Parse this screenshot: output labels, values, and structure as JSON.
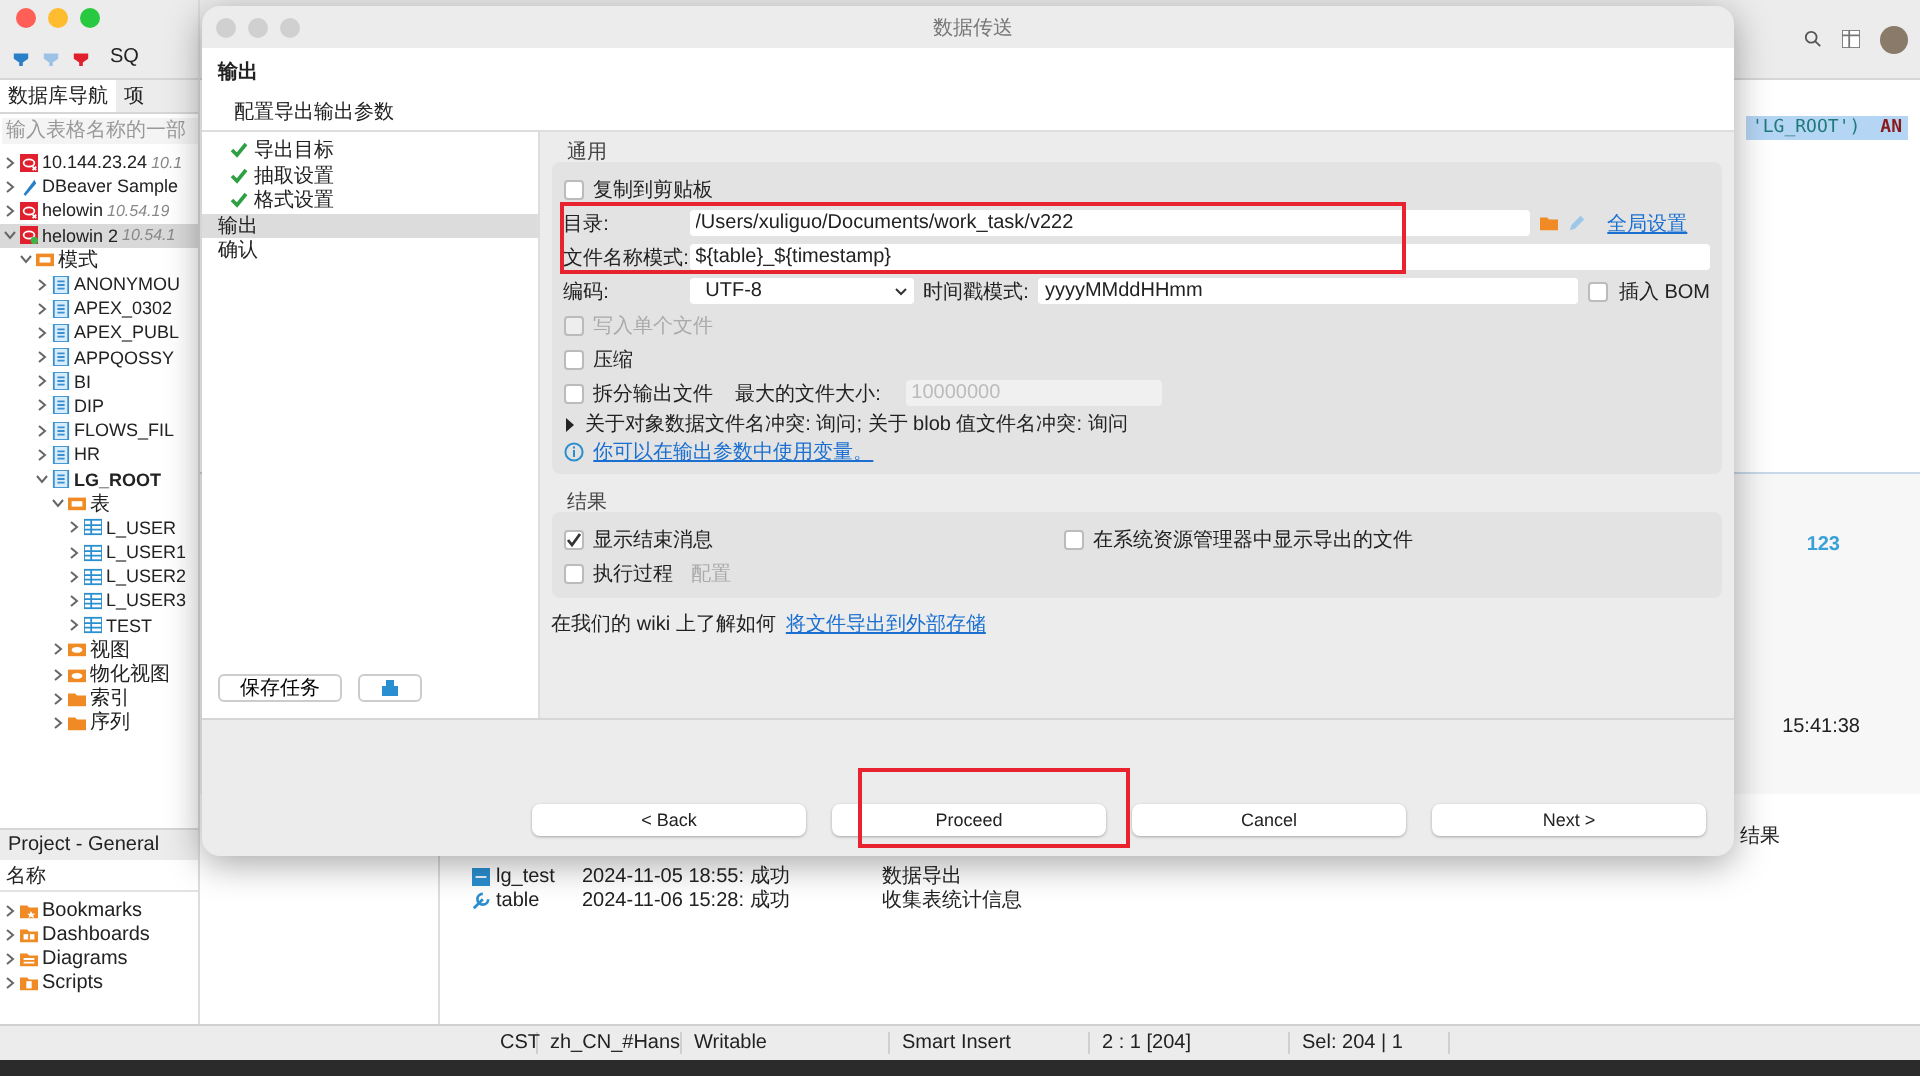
{
  "app": {
    "toolbar": {
      "tab_stub": "SQ"
    },
    "navigator": {
      "tabs": [
        {
          "label": "数据库导航",
          "selected": true
        },
        {
          "label": "项",
          "selected": false
        }
      ],
      "search": {
        "placeholder": "输入表格名称的一部"
      },
      "tree": [
        {
          "label": "10.144.23.24",
          "note": "10.1",
          "kind": "oracle",
          "expanded": false,
          "selected": false
        },
        {
          "label": "DBeaver Sample",
          "kind": "sample",
          "expanded": false,
          "selected": false
        },
        {
          "label": "helowin",
          "note": "10.54.19",
          "kind": "oracle",
          "expanded": false,
          "selected": false
        },
        {
          "label": "helowin 2",
          "note": "10.54.1",
          "kind": "oracle-connected",
          "expanded": true,
          "selected": true,
          "children": [
            {
              "label": "模式",
              "kind": "schemas",
              "expanded": true,
              "selected": false,
              "children": [
                {
                  "label": "ANONYMOU",
                  "kind": "schema",
                  "expanded": false,
                  "selected": false,
                  "active": false
                },
                {
                  "label": "APEX_0302",
                  "kind": "schema",
                  "expanded": false,
                  "selected": false,
                  "active": false
                },
                {
                  "label": "APEX_PUBL",
                  "kind": "schema",
                  "expanded": false,
                  "selected": false,
                  "active": false
                },
                {
                  "label": "APPQOSSY",
                  "kind": "schema",
                  "expanded": false,
                  "selected": false,
                  "active": false
                },
                {
                  "label": "BI",
                  "kind": "schema",
                  "expanded": false,
                  "selected": false,
                  "active": false
                },
                {
                  "label": "DIP",
                  "kind": "schema",
                  "expanded": false,
                  "selected": false,
                  "active": false
                },
                {
                  "label": "FLOWS_FIL",
                  "kind": "schema",
                  "expanded": false,
                  "selected": false,
                  "active": false
                },
                {
                  "label": "HR",
                  "kind": "schema",
                  "expanded": false,
                  "selected": false,
                  "active": false
                },
                {
                  "label": "LG_ROOT",
                  "kind": "schema",
                  "expanded": true,
                  "selected": false,
                  "active": true,
                  "children": [
                    {
                      "label": "表",
                      "kind": "tables",
                      "expanded": true,
                      "selected": false,
                      "children": [
                        {
                          "label": "L_USER",
                          "kind": "table",
                          "expanded": false,
                          "selected": false
                        },
                        {
                          "label": "L_USER1",
                          "kind": "table",
                          "expanded": false,
                          "selected": false
                        },
                        {
                          "label": "L_USER2",
                          "kind": "table",
                          "expanded": false,
                          "selected": false
                        },
                        {
                          "label": "L_USER3",
                          "kind": "table",
                          "expanded": false,
                          "selected": false
                        },
                        {
                          "label": "TEST",
                          "kind": "table",
                          "expanded": false,
                          "selected": false
                        }
                      ]
                    },
                    {
                      "label": "视图",
                      "kind": "views",
                      "expanded": false,
                      "selected": false
                    },
                    {
                      "label": "物化视图",
                      "kind": "views",
                      "expanded": false,
                      "selected": false
                    },
                    {
                      "label": "索引",
                      "kind": "folder",
                      "expanded": false,
                      "selected": false
                    },
                    {
                      "label": "序列",
                      "kind": "folder",
                      "expanded": false,
                      "selected": false
                    }
                  ]
                }
              ]
            }
          ]
        }
      ]
    },
    "project": {
      "title": "Project - General",
      "column": "名称",
      "items": [
        {
          "label": "Bookmarks",
          "kind": "bookmarks"
        },
        {
          "label": "Dashboards",
          "kind": "dashboards"
        },
        {
          "label": "Diagrams",
          "kind": "diagrams"
        },
        {
          "label": "Scripts",
          "kind": "scripts"
        }
      ]
    },
    "editor": {
      "code": "'LG_ROOT')",
      "code_tail": "AN"
    },
    "results": {
      "counter": "123",
      "time": "15:41:38",
      "column": "结果"
    },
    "history": [
      {
        "name": "lg_test",
        "kind": "export",
        "time": "2024-11-05 18:55: 成功",
        "task": "数据导出"
      },
      {
        "name": "table",
        "kind": "tool",
        "time": "2024-11-06 15:28: 成功",
        "task": "收集表统计信息"
      }
    ],
    "status_bar": [
      "CST",
      "zh_CN_#Hans",
      "Writable",
      "Smart Insert",
      "2 : 1 [204]",
      "Sel: 204 | 1"
    ]
  },
  "dialog": {
    "title": "数据传送",
    "heading": "输出",
    "subheading": "配置导出输出参数",
    "steps": [
      {
        "label": "导出目标",
        "done": true,
        "selected": false
      },
      {
        "label": "抽取设置",
        "done": true,
        "selected": false
      },
      {
        "label": "格式设置",
        "done": true,
        "selected": false
      },
      {
        "label": "输出",
        "done": false,
        "selected": true
      },
      {
        "label": "确认",
        "done": false,
        "selected": false
      }
    ],
    "save_task": "保存任务",
    "general": {
      "title": "通用",
      "copy_clipboard": {
        "label": "复制到剪贴板",
        "checked": false
      },
      "paths": {
        "highlighted": true,
        "directory": {
          "label": "目录:",
          "value": "/Users/xuliguo/Documents/work_task/v222"
        },
        "file_pattern": {
          "label": "文件名称模式:",
          "value": "${table}_${timestamp}"
        }
      },
      "global_settings": "全局设置",
      "encoding": {
        "label": "编码:",
        "value": "UTF-8"
      },
      "timestamp": {
        "label": "时间戳模式:",
        "value": "yyyyMMddHHmm"
      },
      "bom": {
        "label": "插入 BOM",
        "checked": false
      },
      "single_file": {
        "label": "写入单个文件",
        "checked": false,
        "disabled": true
      },
      "compress": {
        "label": "压缩",
        "checked": false
      },
      "split": {
        "label": "拆分输出文件",
        "checked": false
      },
      "max_size": {
        "label": "最大的文件大小:",
        "placeholder": "10000000",
        "disabled": true
      },
      "conflicts": "关于对象数据文件名冲突: 询问; 关于 blob 值文件名冲突: 询问",
      "variables_link": "你可以在输出参数中使用变量。"
    },
    "result": {
      "title": "结果",
      "show_message": {
        "label": "显示结束消息",
        "checked": true
      },
      "show_in_explorer": {
        "label": "在系统资源管理器中显示导出的文件",
        "checked": false
      },
      "exec_process": {
        "label": "执行过程",
        "checked": false
      },
      "configure": {
        "label": "配置",
        "disabled": true
      }
    },
    "wiki": {
      "text": "在我们的 wiki 上了解如何",
      "link": "将文件导出到外部存储"
    },
    "buttons": [
      {
        "label": "< Back",
        "highlighted": false
      },
      {
        "label": "Proceed",
        "highlighted": true
      },
      {
        "label": "Cancel",
        "highlighted": false
      },
      {
        "label": "Next >",
        "highlighted": false
      }
    ]
  }
}
